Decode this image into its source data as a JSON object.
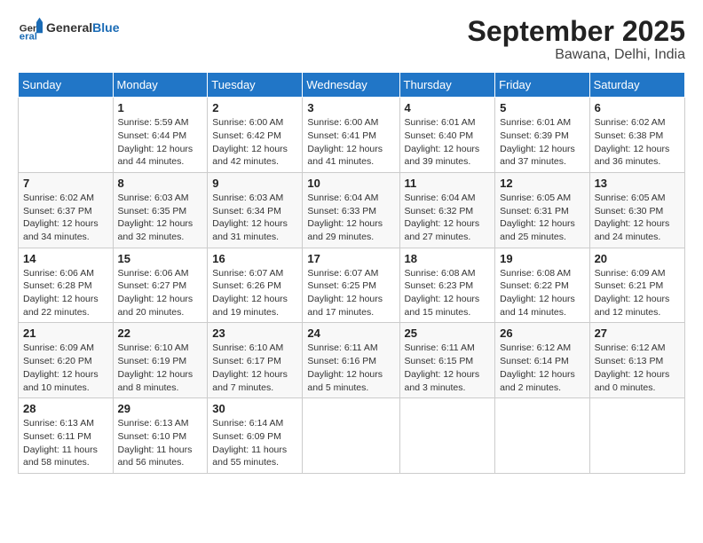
{
  "header": {
    "logo_general": "General",
    "logo_blue": "Blue",
    "month_title": "September 2025",
    "location": "Bawana, Delhi, India"
  },
  "weekdays": [
    "Sunday",
    "Monday",
    "Tuesday",
    "Wednesday",
    "Thursday",
    "Friday",
    "Saturday"
  ],
  "weeks": [
    [
      {
        "day": "",
        "info": ""
      },
      {
        "day": "1",
        "info": "Sunrise: 5:59 AM\nSunset: 6:44 PM\nDaylight: 12 hours\nand 44 minutes."
      },
      {
        "day": "2",
        "info": "Sunrise: 6:00 AM\nSunset: 6:42 PM\nDaylight: 12 hours\nand 42 minutes."
      },
      {
        "day": "3",
        "info": "Sunrise: 6:00 AM\nSunset: 6:41 PM\nDaylight: 12 hours\nand 41 minutes."
      },
      {
        "day": "4",
        "info": "Sunrise: 6:01 AM\nSunset: 6:40 PM\nDaylight: 12 hours\nand 39 minutes."
      },
      {
        "day": "5",
        "info": "Sunrise: 6:01 AM\nSunset: 6:39 PM\nDaylight: 12 hours\nand 37 minutes."
      },
      {
        "day": "6",
        "info": "Sunrise: 6:02 AM\nSunset: 6:38 PM\nDaylight: 12 hours\nand 36 minutes."
      }
    ],
    [
      {
        "day": "7",
        "info": "Sunrise: 6:02 AM\nSunset: 6:37 PM\nDaylight: 12 hours\nand 34 minutes."
      },
      {
        "day": "8",
        "info": "Sunrise: 6:03 AM\nSunset: 6:35 PM\nDaylight: 12 hours\nand 32 minutes."
      },
      {
        "day": "9",
        "info": "Sunrise: 6:03 AM\nSunset: 6:34 PM\nDaylight: 12 hours\nand 31 minutes."
      },
      {
        "day": "10",
        "info": "Sunrise: 6:04 AM\nSunset: 6:33 PM\nDaylight: 12 hours\nand 29 minutes."
      },
      {
        "day": "11",
        "info": "Sunrise: 6:04 AM\nSunset: 6:32 PM\nDaylight: 12 hours\nand 27 minutes."
      },
      {
        "day": "12",
        "info": "Sunrise: 6:05 AM\nSunset: 6:31 PM\nDaylight: 12 hours\nand 25 minutes."
      },
      {
        "day": "13",
        "info": "Sunrise: 6:05 AM\nSunset: 6:30 PM\nDaylight: 12 hours\nand 24 minutes."
      }
    ],
    [
      {
        "day": "14",
        "info": "Sunrise: 6:06 AM\nSunset: 6:28 PM\nDaylight: 12 hours\nand 22 minutes."
      },
      {
        "day": "15",
        "info": "Sunrise: 6:06 AM\nSunset: 6:27 PM\nDaylight: 12 hours\nand 20 minutes."
      },
      {
        "day": "16",
        "info": "Sunrise: 6:07 AM\nSunset: 6:26 PM\nDaylight: 12 hours\nand 19 minutes."
      },
      {
        "day": "17",
        "info": "Sunrise: 6:07 AM\nSunset: 6:25 PM\nDaylight: 12 hours\nand 17 minutes."
      },
      {
        "day": "18",
        "info": "Sunrise: 6:08 AM\nSunset: 6:23 PM\nDaylight: 12 hours\nand 15 minutes."
      },
      {
        "day": "19",
        "info": "Sunrise: 6:08 AM\nSunset: 6:22 PM\nDaylight: 12 hours\nand 14 minutes."
      },
      {
        "day": "20",
        "info": "Sunrise: 6:09 AM\nSunset: 6:21 PM\nDaylight: 12 hours\nand 12 minutes."
      }
    ],
    [
      {
        "day": "21",
        "info": "Sunrise: 6:09 AM\nSunset: 6:20 PM\nDaylight: 12 hours\nand 10 minutes."
      },
      {
        "day": "22",
        "info": "Sunrise: 6:10 AM\nSunset: 6:19 PM\nDaylight: 12 hours\nand 8 minutes."
      },
      {
        "day": "23",
        "info": "Sunrise: 6:10 AM\nSunset: 6:17 PM\nDaylight: 12 hours\nand 7 minutes."
      },
      {
        "day": "24",
        "info": "Sunrise: 6:11 AM\nSunset: 6:16 PM\nDaylight: 12 hours\nand 5 minutes."
      },
      {
        "day": "25",
        "info": "Sunrise: 6:11 AM\nSunset: 6:15 PM\nDaylight: 12 hours\nand 3 minutes."
      },
      {
        "day": "26",
        "info": "Sunrise: 6:12 AM\nSunset: 6:14 PM\nDaylight: 12 hours\nand 2 minutes."
      },
      {
        "day": "27",
        "info": "Sunrise: 6:12 AM\nSunset: 6:13 PM\nDaylight: 12 hours\nand 0 minutes."
      }
    ],
    [
      {
        "day": "28",
        "info": "Sunrise: 6:13 AM\nSunset: 6:11 PM\nDaylight: 11 hours\nand 58 minutes."
      },
      {
        "day": "29",
        "info": "Sunrise: 6:13 AM\nSunset: 6:10 PM\nDaylight: 11 hours\nand 56 minutes."
      },
      {
        "day": "30",
        "info": "Sunrise: 6:14 AM\nSunset: 6:09 PM\nDaylight: 11 hours\nand 55 minutes."
      },
      {
        "day": "",
        "info": ""
      },
      {
        "day": "",
        "info": ""
      },
      {
        "day": "",
        "info": ""
      },
      {
        "day": "",
        "info": ""
      }
    ]
  ]
}
